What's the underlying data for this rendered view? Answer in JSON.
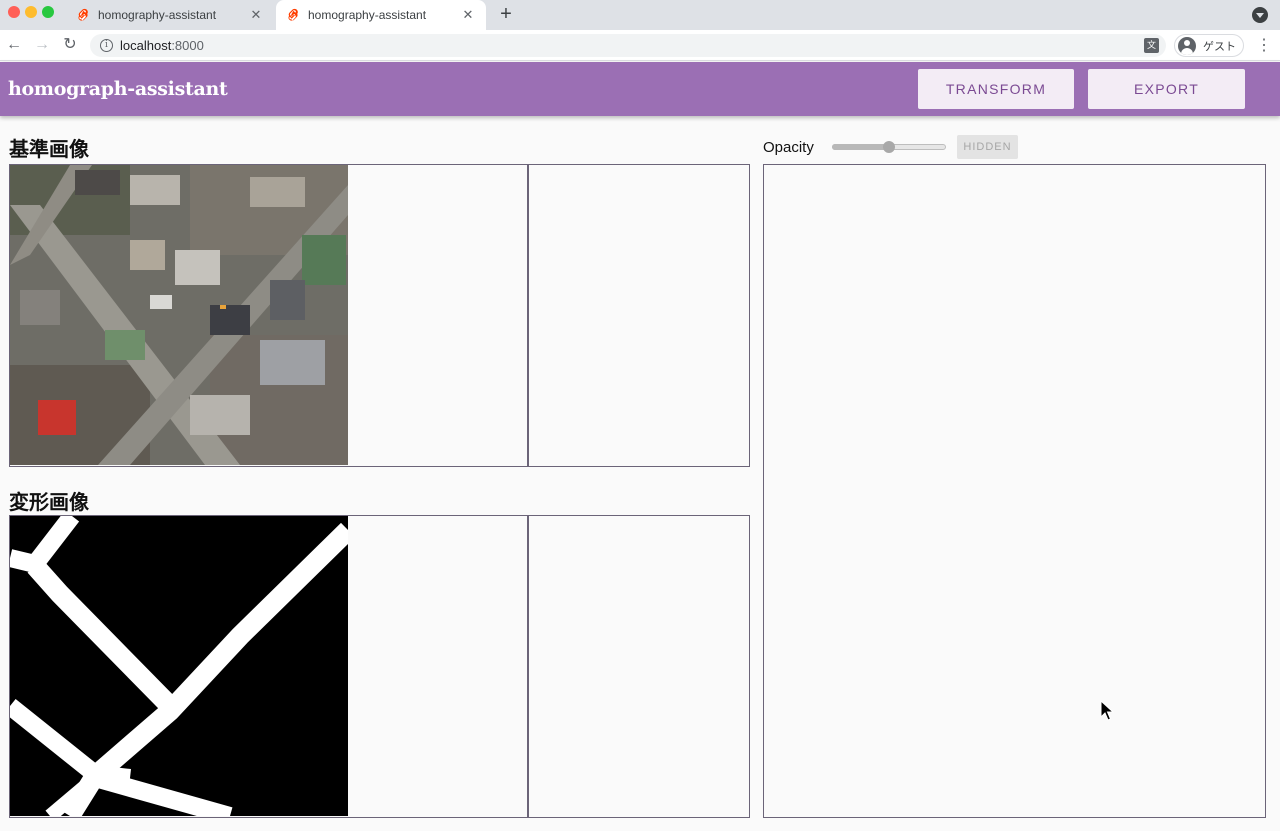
{
  "browser": {
    "tabs": [
      {
        "title": "homography-assistant",
        "active": false
      },
      {
        "title": "homography-assistant",
        "active": true
      }
    ],
    "url_host": "localhost",
    "url_port": ":8000",
    "profile_name": "ゲスト"
  },
  "header": {
    "brand": "homograph-assistant",
    "transform_label": "TRANSFORM",
    "export_label": "EXPORT",
    "color": "#9b6fb4"
  },
  "base_image": {
    "title": "基準画像"
  },
  "transformed_image": {
    "title": "変形画像"
  },
  "overlay": {
    "opacity_label": "Opacity",
    "opacity_value": 0.5,
    "hidden_label": "HIDDEN"
  }
}
